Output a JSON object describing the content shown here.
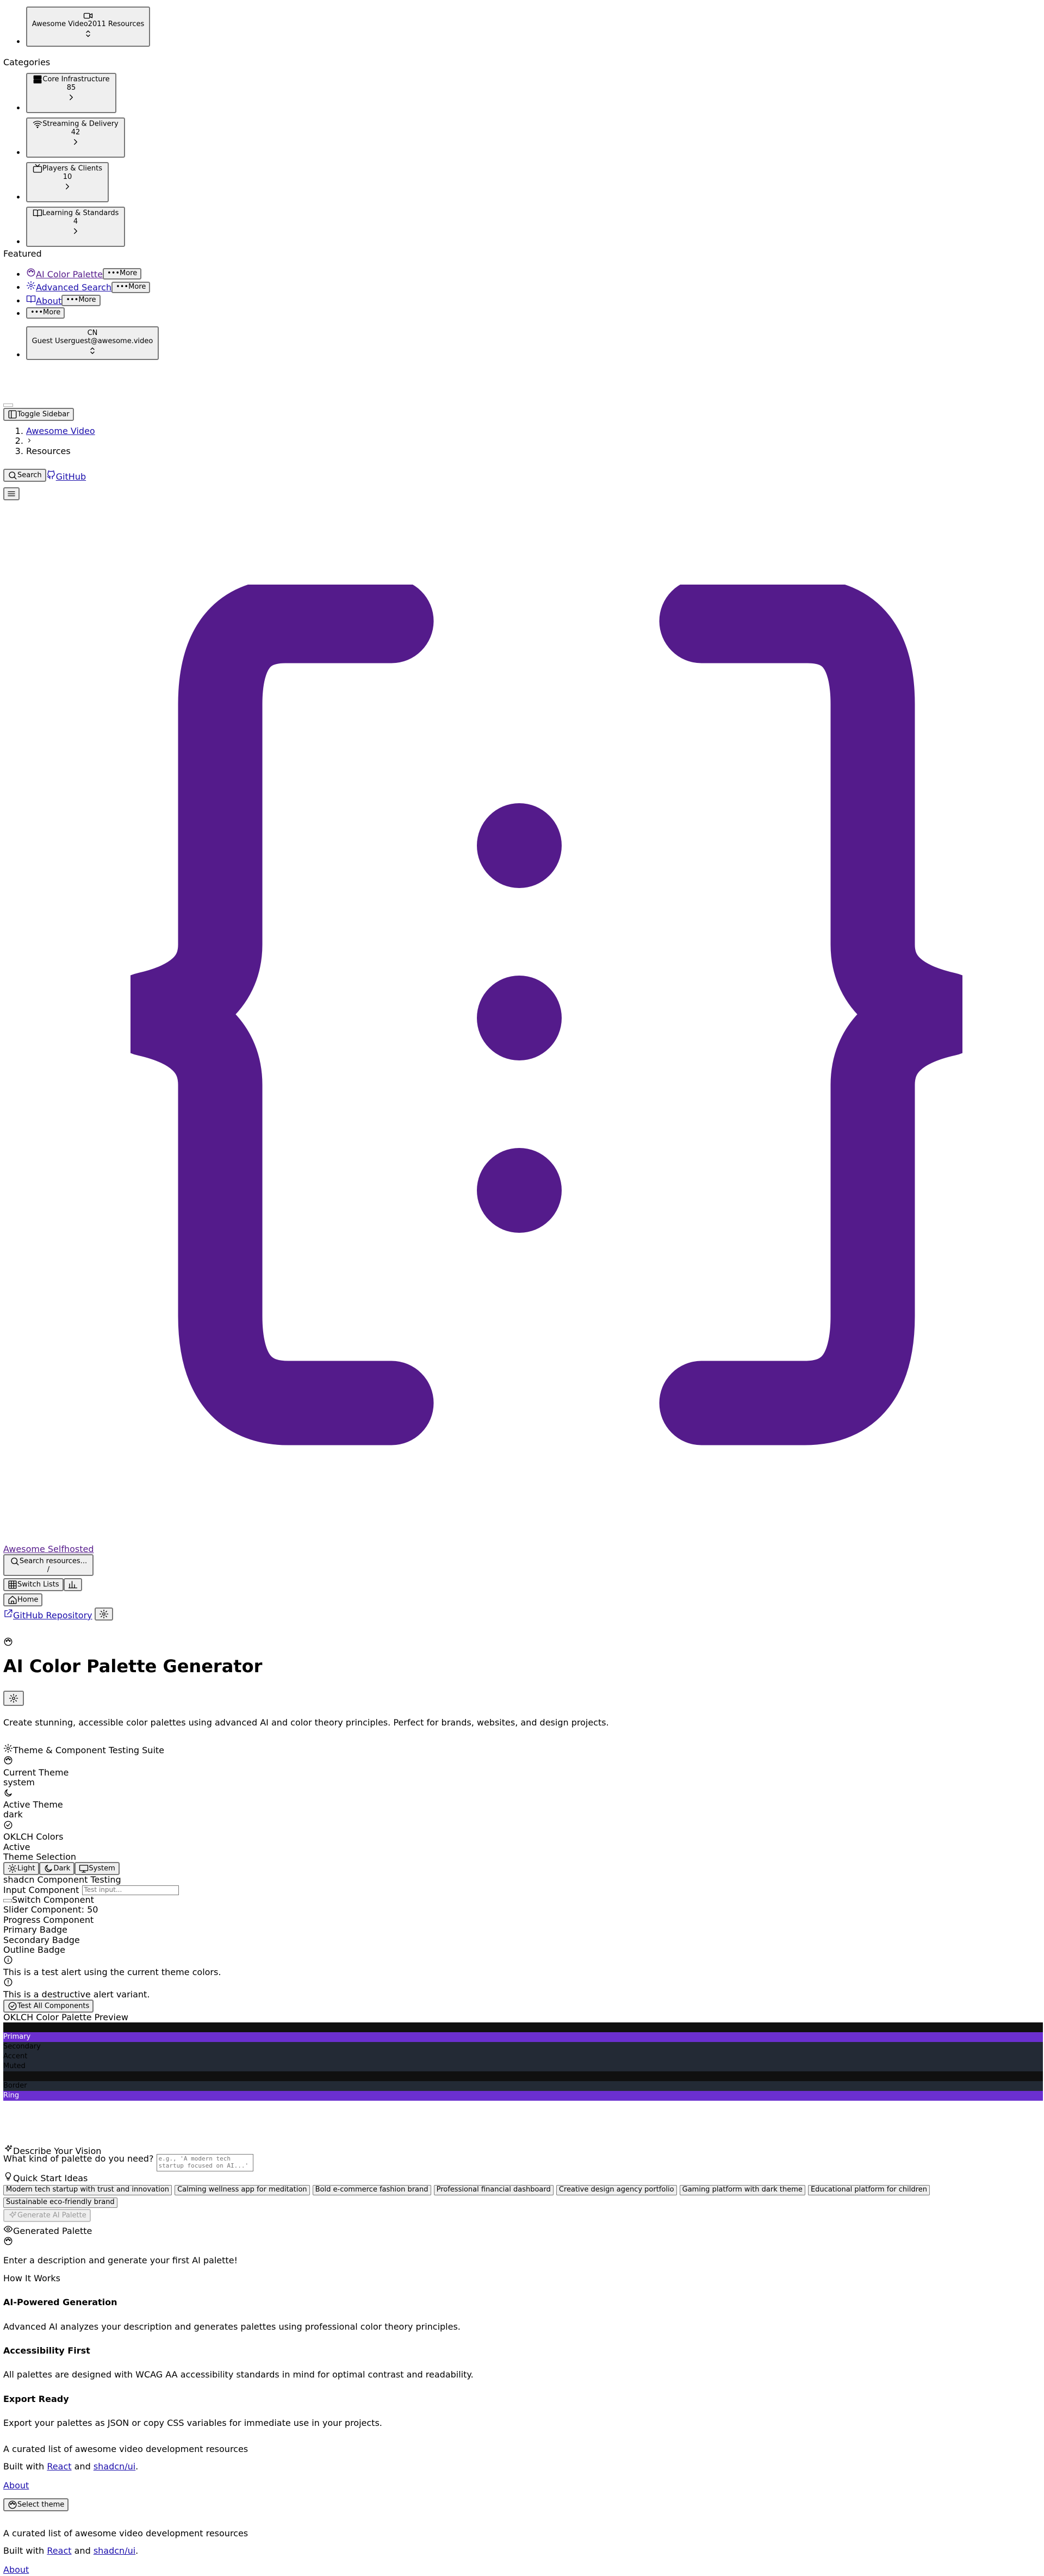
{
  "team": {
    "name": "Awesome Video",
    "count": "2011 Resources"
  },
  "categories_heading": "Categories",
  "categories": [
    {
      "name": "Core Infrastructure",
      "count": "85"
    },
    {
      "name": "Streaming & Delivery",
      "count": "42"
    },
    {
      "name": "Players & Clients",
      "count": "10"
    },
    {
      "name": "Learning & Standards",
      "count": "4"
    }
  ],
  "featured_heading": "Featured",
  "featured": {
    "item1": "AI Color Palette",
    "item2": "Advanced Search",
    "item3": "About",
    "more": "More"
  },
  "user": {
    "initials": "CN",
    "name": "Guest User",
    "email": "guest@awesome.video"
  },
  "header": {
    "toggle_sidebar": "Toggle Sidebar",
    "breadcrumb": [
      "Awesome Video",
      "Resources"
    ],
    "search": "Search",
    "github": "GitHub"
  },
  "brand": {
    "name": "Awesome Selfhosted",
    "search_placeholder": "Search resources...",
    "search_key": "/",
    "switch_lists": "Switch Lists",
    "home": "Home",
    "github_repo": "GitHub Repository",
    "logo_color": "#541b8b"
  },
  "page": {
    "title": "AI Color Palette Generator",
    "description": "Create stunning, accessible color palettes using advanced AI and color theory principles. Perfect for brands, websites, and design projects."
  },
  "suite": {
    "title": "Theme & Component Testing Suite",
    "current_theme_label": "Current Theme",
    "current_theme_value": "system",
    "active_theme_label": "Active Theme",
    "active_theme_value": "dark",
    "oklch_label": "OKLCH Colors",
    "oklch_value": "Active",
    "theme_selection": "Theme Selection",
    "light": "Light",
    "dark": "Dark",
    "system": "System",
    "shadcn_testing": "shadcn Component Testing",
    "input_component": "Input Component",
    "input_placeholder": "Test input...",
    "switch_component": "Switch Component",
    "slider_component": "Slider Component: 50",
    "progress_component": "Progress Component",
    "primary_badge": "Primary Badge",
    "secondary_badge": "Secondary Badge",
    "outline_badge": "Outline Badge",
    "alert_text": "This is a test alert using the current theme colors.",
    "destructive_text": "This is a destructive alert variant.",
    "test_all": "Test All Components",
    "oklch_preview": "OKLCH Color Palette Preview"
  },
  "palette_rows": [
    {
      "label": "",
      "color": "#101010",
      "text": "#ffffff"
    },
    {
      "label": "Primary",
      "color": "#6b2fd0",
      "text": "#ffffff"
    },
    {
      "label": "Secondary",
      "color": "#232a35",
      "text": "#000000"
    },
    {
      "label": "Accent",
      "color": "#232a35",
      "text": "#000000"
    },
    {
      "label": "Muted",
      "color": "#232a35",
      "text": "#000000"
    },
    {
      "label": "",
      "color": "#101010",
      "text": "#ffffff"
    },
    {
      "label": "Border",
      "color": "#232a35",
      "text": "#000000"
    },
    {
      "label": "Ring",
      "color": "#6b2fd0",
      "text": "#ffffff"
    }
  ],
  "describe": {
    "title": "Describe Your Vision",
    "prompt_label": "What kind of palette do you need?",
    "placeholder": "e.g., 'A modern tech startup focused on AI...'",
    "quick_start": "Quick Start Ideas",
    "ideas": [
      "Modern tech startup with trust and innovation",
      "Calming wellness app for meditation",
      "Bold e-commerce fashion brand",
      "Professional financial dashboard",
      "Creative design agency portfolio",
      "Gaming platform with dark theme",
      "Educational platform for children",
      "Sustainable eco-friendly brand"
    ],
    "generate": "Generate AI Palette"
  },
  "generated": {
    "title": "Generated Palette",
    "empty": "Enter a description and generate your first AI palette!"
  },
  "how": {
    "title": "How It Works",
    "items": [
      {
        "heading": "AI-Powered Generation",
        "text": "Advanced AI analyzes your description and generates palettes using professional color theory principles."
      },
      {
        "heading": "Accessibility First",
        "text": "All palettes are designed with WCAG AA accessibility standards in mind for optimal contrast and readability."
      },
      {
        "heading": "Export Ready",
        "text": "Export your palettes as JSON or copy CSS variables for immediate use in your projects."
      }
    ]
  },
  "footer": {
    "tagline": "A curated list of awesome video development resources",
    "built_prefix": "Built with ",
    "react": "React",
    "and": " and ",
    "shadcn": "shadcn/ui",
    "period": ".",
    "about": "About",
    "select_theme": "Select theme"
  }
}
